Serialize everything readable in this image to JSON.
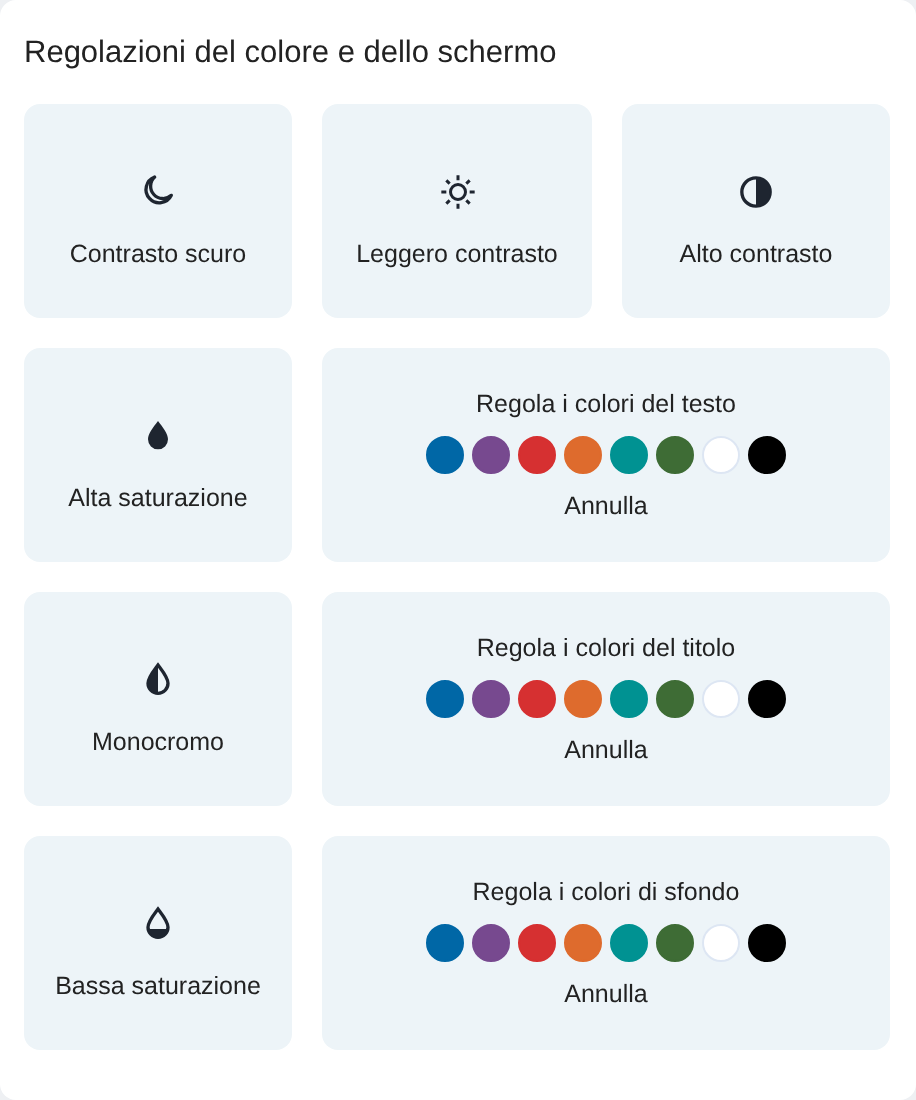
{
  "title": "Regolazioni del colore e dello schermo",
  "tiles": [
    {
      "kind": "moon",
      "label": "Contrasto scuro"
    },
    {
      "kind": "sun",
      "label": "Leggero contrasto"
    },
    {
      "kind": "contrast",
      "label": "Alto contrasto"
    },
    {
      "kind": "drop-full",
      "label": "Alta saturazione"
    },
    {
      "kind": "palette",
      "title": "Regola i colori del testo",
      "swatches": [
        {
          "color": "#0067a6"
        },
        {
          "color": "#77498f"
        },
        {
          "color": "#d63031"
        },
        {
          "color": "#de6b2d"
        },
        {
          "color": "#009292"
        },
        {
          "color": "#3e6c35"
        },
        {
          "color": "#ffffff"
        },
        {
          "color": "#000000"
        }
      ],
      "reset": "Annulla"
    },
    {
      "kind": "drop-half",
      "label": "Monocromo"
    },
    {
      "kind": "palette",
      "title": "Regola i colori del titolo",
      "swatches": [
        {
          "color": "#0067a6"
        },
        {
          "color": "#77498f"
        },
        {
          "color": "#d63031"
        },
        {
          "color": "#de6b2d"
        },
        {
          "color": "#009292"
        },
        {
          "color": "#3e6c35"
        },
        {
          "color": "#ffffff"
        },
        {
          "color": "#000000"
        }
      ],
      "reset": "Annulla"
    },
    {
      "kind": "drop-low",
      "label": "Bassa saturazione"
    },
    {
      "kind": "palette",
      "title": "Regola i colori di sfondo",
      "swatches": [
        {
          "color": "#0067a6"
        },
        {
          "color": "#77498f"
        },
        {
          "color": "#d63031"
        },
        {
          "color": "#de6b2d"
        },
        {
          "color": "#009292"
        },
        {
          "color": "#3e6c35"
        },
        {
          "color": "#ffffff"
        },
        {
          "color": "#000000"
        }
      ],
      "reset": "Annulla"
    }
  ]
}
